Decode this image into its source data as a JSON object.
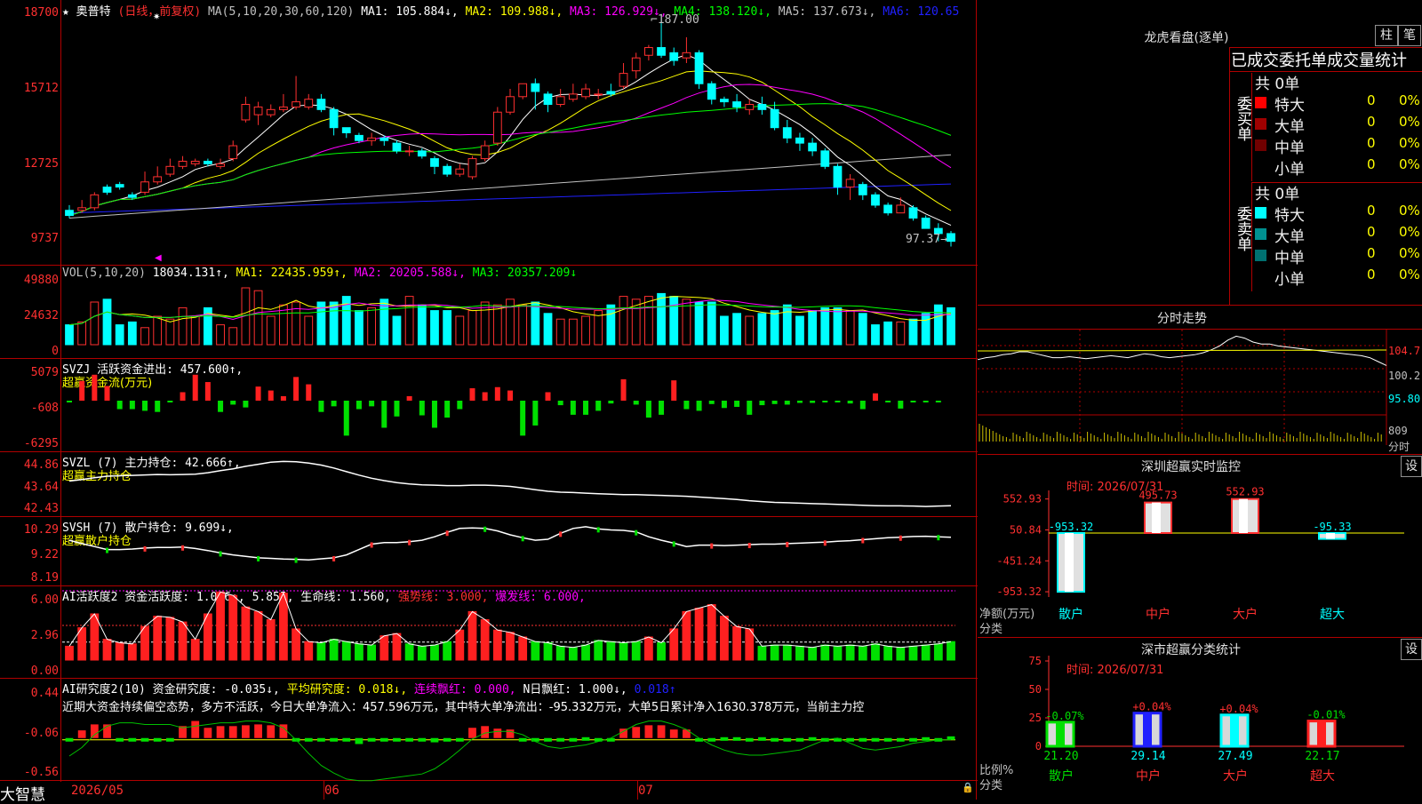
{
  "chart": {
    "stock_name": "奥普特",
    "period_label": "(日线，前复权)",
    "ma_header": "MA(5,10,20,30,60,120)",
    "ma_values": [
      {
        "label": "MA1: 105.884↓,",
        "color": "#ffffff"
      },
      {
        "label": "MA2: 109.988↓,",
        "color": "#ffff00"
      },
      {
        "label": "MA3: 126.929↓,",
        "color": "#ff00ff"
      },
      {
        "label": "MA4: 138.120↓,",
        "color": "#00ff00"
      },
      {
        "label": "MA5: 137.673↓,",
        "color": "#c0c0c0"
      },
      {
        "label": "MA6: 120.65",
        "color": "#2020ff"
      }
    ],
    "price_axis": [
      "18700",
      "15712",
      "12725",
      "9737"
    ],
    "high_annot": "187.00",
    "low_annot": "97.37→",
    "vol_header": "VOL(5,10,20)",
    "vol_value": "18034.131↑,",
    "vol_ma": [
      {
        "label": "MA1: 22435.959↑,",
        "color": "#ffff00"
      },
      {
        "label": "MA2: 20205.588↓,",
        "color": "#ff00ff"
      },
      {
        "label": "MA3: 20357.209↓",
        "color": "#00ff00"
      }
    ],
    "vol_axis": [
      "49880",
      "24632",
      "0"
    ],
    "svzj_header": "SVZJ  活跃资金进出: 457.600↑,",
    "svzj_sub": "超赢资金流(万元)",
    "svzj_axis": [
      "5079",
      "-608",
      "-6295"
    ],
    "svzl_header": "SVZL (7) 主力持仓: 42.666↑,",
    "svzl_sub": "超赢主力持仓",
    "svzl_axis": [
      "44.86",
      "43.64",
      "42.43"
    ],
    "svsh_header": "SVSH (7) 散户持仓: 9.699↓,",
    "svsh_sub": "超赢散户持仓",
    "svsh_axis": [
      "10.29",
      "9.22",
      "8.19"
    ],
    "ai1_header": "AI活跃度2 资金活跃度: 1.076↓, 5.855, 生命线: 1.560,",
    "ai1_strong": "强势线: 3.000,",
    "ai1_burst": "爆发线: 6.000,",
    "ai1_axis": [
      "6.00",
      "2.96",
      "0.00"
    ],
    "ai2_header_a": "AI研究度2(10) 资金研究度: -0.035↓,",
    "ai2_header_b": "平均研究度: 0.018↓,",
    "ai2_header_c": "连续飘红: 0.000,",
    "ai2_header_d": "N日飘红: 1.000↓,",
    "ai2_header_e": "0.018↑",
    "ai2_text": "近期大资金持续偏空态势，多方不活跃，今日大单净流入：457.596万元，其中特大单净流出：-95.332万元，大单5日累计净入1630.378万元，当前主力控",
    "ai2_axis": [
      "0.44",
      "-0.06",
      "-0.56"
    ],
    "brand": "大智慧",
    "date_labels": [
      "2026/05",
      "06",
      "07"
    ]
  },
  "right": {
    "lhb_title": "龙虎看盘(逐单)",
    "btn_bar": "柱",
    "btn_pen": "笔",
    "tabs_title": "已成交委托单成交量统计",
    "buy_label": "委买单",
    "sell_label": "委卖单",
    "buy_total": "共 0单",
    "sell_total": "共 0单",
    "buy_rows": [
      {
        "name": "特大",
        "count": "0",
        "pct": "0%",
        "color": "#ff0000"
      },
      {
        "name": "大单",
        "count": "0",
        "pct": "0%",
        "color": "#a00000"
      },
      {
        "name": "中单",
        "count": "0",
        "pct": "0%",
        "color": "#700000"
      },
      {
        "name": "小单",
        "count": "0",
        "pct": "0%",
        "color": "#000000"
      }
    ],
    "sell_rows": [
      {
        "name": "特大",
        "count": "0",
        "pct": "0%",
        "color": "#00ffff"
      },
      {
        "name": "大单",
        "count": "0",
        "pct": "0%",
        "color": "#009090"
      },
      {
        "name": "中单",
        "count": "0",
        "pct": "0%",
        "color": "#007070"
      },
      {
        "name": "小单",
        "count": "0",
        "pct": "0%",
        "color": "#000000"
      }
    ],
    "fs_title": "分时走势",
    "fs_axis": [
      "104.7",
      "100.2",
      "95.80",
      "809",
      "分时"
    ],
    "monitor_title": "深圳超赢实时监控",
    "monitor_btn": "设",
    "monitor_time": "时间: 2026/07/31",
    "monitor_axis": [
      "552.93",
      "50.84",
      "-451.24",
      "-953.32"
    ],
    "monitor_ylabel": "净额(万元)",
    "monitor_xlabel": "分类",
    "monitor_vals": [
      "-953.32",
      "495.73",
      "552.93",
      "-95.33"
    ],
    "monitor_cats": [
      "散户",
      "中户",
      "大户",
      "超大"
    ],
    "stat_title": "深市超赢分类统计",
    "stat_btn": "设",
    "stat_time": "时间: 2026/07/31",
    "stat_axis": [
      "75",
      "50",
      "25",
      "0"
    ],
    "stat_ylabel": "比例%",
    "stat_xlabel": "分类",
    "stat_top": [
      "-0.07%",
      "+0.04%",
      "+0.04%",
      "-0.01%"
    ],
    "stat_vals": [
      "21.20",
      "29.14",
      "27.49",
      "22.17"
    ],
    "stat_cats": [
      "散户",
      "中户",
      "大户",
      "超大"
    ]
  },
  "chart_data": {
    "type": "candlestick",
    "price_axis_range": [
      9737,
      18700
    ],
    "candles": [
      [
        111,
        109,
        113,
        108
      ],
      [
        111,
        112,
        115,
        110
      ],
      [
        112,
        117,
        118,
        111
      ],
      [
        120,
        118,
        121,
        117
      ],
      [
        121,
        120,
        122,
        119
      ],
      [
        117,
        116,
        118,
        115
      ],
      [
        118,
        122,
        126,
        117
      ],
      [
        122,
        124,
        128,
        121
      ],
      [
        125,
        128,
        131,
        124
      ],
      [
        128,
        130,
        132,
        127
      ],
      [
        129,
        130,
        131,
        128
      ],
      [
        130,
        129,
        131,
        128
      ],
      [
        128,
        129,
        131,
        127
      ],
      [
        131,
        136,
        138,
        130
      ],
      [
        146,
        152,
        155,
        145
      ],
      [
        148,
        151,
        153,
        144
      ],
      [
        148,
        150,
        152,
        147
      ],
      [
        150,
        151,
        156,
        149
      ],
      [
        151,
        153,
        163,
        150
      ],
      [
        151,
        154,
        156,
        150
      ],
      [
        154,
        150,
        156,
        149
      ],
      [
        150,
        143,
        151,
        140
      ],
      [
        143,
        141,
        142,
        139
      ],
      [
        140,
        138,
        141,
        137
      ],
      [
        138,
        139,
        141,
        136
      ],
      [
        139,
        138,
        140,
        136
      ],
      [
        137,
        134,
        138,
        133
      ],
      [
        134,
        134,
        136,
        132
      ],
      [
        134,
        132,
        135,
        131
      ],
      [
        131,
        128,
        132,
        125
      ],
      [
        128,
        125,
        129,
        124
      ],
      [
        125,
        127,
        129,
        124
      ],
      [
        124,
        131,
        132,
        123
      ],
      [
        131,
        136,
        138,
        130
      ],
      [
        137,
        149,
        151,
        136
      ],
      [
        149,
        155,
        158,
        148
      ],
      [
        155,
        160,
        160,
        154
      ],
      [
        160,
        157,
        162,
        150
      ],
      [
        156,
        152,
        157,
        149
      ],
      [
        152,
        155,
        158,
        151
      ],
      [
        154,
        156,
        160,
        153
      ],
      [
        155,
        158,
        160,
        154
      ],
      [
        156,
        156,
        158,
        154
      ],
      [
        157,
        156,
        160,
        155
      ],
      [
        159,
        164,
        168,
        158
      ],
      [
        165,
        170,
        172,
        162
      ],
      [
        171,
        174,
        175,
        169
      ],
      [
        174,
        171,
        187,
        170
      ],
      [
        172,
        169,
        174,
        167
      ],
      [
        170,
        172,
        178,
        168
      ],
      [
        172,
        160,
        173,
        158
      ],
      [
        160,
        154,
        161,
        152
      ],
      [
        154,
        153,
        155,
        151
      ],
      [
        153,
        151,
        156,
        149
      ],
      [
        150,
        152,
        154,
        148
      ],
      [
        152,
        150,
        155,
        148
      ],
      [
        150,
        143,
        153,
        142
      ],
      [
        143,
        139,
        146,
        137
      ],
      [
        139,
        137,
        141,
        134
      ],
      [
        137,
        134,
        139,
        132
      ],
      [
        134,
        128,
        135,
        127
      ],
      [
        128,
        120,
        129,
        117
      ],
      [
        120,
        123,
        125,
        115
      ],
      [
        121,
        117,
        122,
        115
      ],
      [
        117,
        113,
        118,
        112
      ],
      [
        113,
        110,
        114,
        109
      ],
      [
        110,
        113,
        116,
        110
      ],
      [
        112,
        108,
        113,
        107
      ],
      [
        108,
        104,
        109,
        104
      ],
      [
        104,
        102,
        106,
        99
      ],
      [
        102,
        99,
        103,
        97
      ]
    ],
    "volume": [
      14,
      16,
      30,
      32,
      14,
      16,
      12,
      20,
      18,
      26,
      20,
      26,
      14,
      12,
      40,
      38,
      20,
      28,
      30,
      20,
      30,
      30,
      34,
      24,
      26,
      32,
      20,
      34,
      28,
      24,
      24,
      20,
      24,
      30,
      28,
      32,
      28,
      30,
      22,
      18,
      18,
      20,
      24,
      28,
      34,
      32,
      34,
      36,
      34,
      32,
      30,
      30,
      20,
      22,
      20,
      22,
      24,
      28,
      20,
      24,
      26,
      26,
      24,
      22,
      14,
      16,
      16,
      18,
      22,
      28,
      26,
      18,
      20
    ],
    "svzj": [
      -0.3,
      3.5,
      4.6,
      2.6,
      -1.5,
      -1.5,
      -1.8,
      -2.0,
      -0.1,
      1.5,
      4.6,
      3.3,
      -2.0,
      -0.7,
      -1.2,
      2.5,
      1.8,
      0.8,
      4.2,
      2.9,
      -2.0,
      -1.0,
      -6.2,
      -1.5,
      -1.0,
      -4.8,
      -2.8,
      0.8,
      -2.6,
      -4.8,
      -3.0,
      -1.5,
      2.2,
      1.5,
      2.4,
      1.8,
      -6.2,
      -4.4,
      1.5,
      -0.8,
      -2.5,
      -2.5,
      -1.8,
      -0.5,
      3.8,
      -0.7,
      -3.0,
      -2.5,
      3.6,
      -1.5,
      -1.8,
      -0.6,
      -1.3,
      -1.1,
      -2.5,
      -0.8,
      -0.6,
      -0.7,
      -0.4,
      -0.4,
      -0.3,
      -0.3,
      -0.5,
      -1.5,
      1.3,
      -0.3,
      -1.4,
      -0.3,
      -0.3,
      -0.3
    ],
    "svzl": [
      43.84,
      43.92,
      44.0,
      44.08,
      44.1,
      44.12,
      44.14,
      44.16,
      44.15,
      44.16,
      44.18,
      44.25,
      44.35,
      44.44,
      44.56,
      44.66,
      44.76,
      44.8,
      44.78,
      44.72,
      44.62,
      44.48,
      44.3,
      44.13,
      43.98,
      43.86,
      43.76,
      43.7,
      43.66,
      43.64,
      43.62,
      43.62,
      43.64,
      43.64,
      43.62,
      43.58,
      43.5,
      43.42,
      43.34,
      43.3,
      43.28,
      43.25,
      43.22,
      43.2,
      43.18,
      43.18,
      43.16,
      43.14,
      43.12,
      43.1,
      43.06,
      43.02,
      42.98,
      42.94,
      42.88,
      42.84,
      42.8,
      42.78,
      42.76,
      42.74,
      42.72,
      42.7,
      42.68,
      42.66,
      42.64,
      42.63,
      42.63,
      42.62,
      42.6,
      42.62,
      42.64,
      42.66
    ],
    "svsh": [
      9.6,
      9.46,
      9.34,
      9.22,
      9.22,
      9.24,
      9.28,
      9.3,
      9.3,
      9.32,
      9.26,
      9.18,
      9.08,
      9.0,
      8.94,
      8.88,
      8.86,
      8.83,
      8.82,
      8.8,
      8.84,
      8.88,
      9.0,
      9.22,
      9.44,
      9.5,
      9.5,
      9.54,
      9.6,
      9.74,
      9.92,
      10.08,
      10.1,
      10.08,
      9.98,
      9.82,
      9.7,
      9.6,
      9.64,
      9.88,
      10.08,
      10.15,
      10.06,
      10.02,
      10.0,
      9.94,
      9.74,
      9.6,
      9.48,
      9.34,
      9.4,
      9.4,
      9.38,
      9.4,
      9.42,
      9.44,
      9.44,
      9.46,
      9.48,
      9.5,
      9.52,
      9.56,
      9.58,
      9.62,
      9.66,
      9.7,
      9.72,
      9.75,
      9.76,
      9.74,
      9.72,
      9.7
    ],
    "ai1": [
      1.2,
      2.8,
      4.0,
      1.8,
      1.5,
      1.4,
      2.9,
      3.8,
      3.7,
      3.3,
      1.8,
      4.0,
      5.9,
      5.6,
      4.6,
      4.2,
      3.5,
      5.8,
      2.7,
      1.6,
      1.5,
      1.8,
      1.6,
      1.4,
      1.3,
      2.1,
      2.3,
      1.4,
      1.2,
      1.3,
      1.6,
      2.6,
      4.2,
      3.5,
      2.6,
      2.4,
      2.0,
      1.6,
      1.5,
      1.2,
      1.1,
      1.3,
      1.7,
      1.6,
      1.5,
      1.6,
      2.0,
      1.5,
      2.7,
      4.2,
      4.5,
      4.8,
      3.8,
      2.9,
      2.7,
      1.2,
      1.3,
      1.3,
      1.2,
      1.1,
      1.3,
      1.2,
      1.3,
      1.2,
      1.4,
      1.2,
      1.1,
      1.2,
      1.3,
      1.4,
      1.6,
      1.3,
      1.1
    ],
    "ai2_bars": [
      -0.06,
      0.03,
      0.1,
      0.1,
      -0.06,
      -0.06,
      -0.06,
      -0.06,
      -0.06,
      0.08,
      0.14,
      0.06,
      0.08,
      0.08,
      0.09,
      0.1,
      0.09,
      0.1,
      -0.06,
      -0.06,
      -0.08,
      -0.08,
      -0.1,
      -0.13,
      -0.1,
      -0.08,
      -0.09,
      -0.08,
      -0.07,
      -0.11,
      -0.1,
      -0.08,
      0.06,
      0.08,
      0.05,
      0.04,
      -0.06,
      -0.06,
      -0.09,
      -0.06,
      -0.06,
      -0.05,
      -0.06,
      -0.06,
      0.05,
      0.07,
      0.09,
      0.09,
      0.04,
      0.04,
      -0.06,
      -0.06,
      -0.05,
      -0.05,
      -0.06,
      -0.05,
      -0.06,
      -0.07,
      -0.06,
      -0.05,
      -0.06,
      -0.06,
      -0.08,
      -0.06,
      -0.06,
      -0.06,
      -0.07,
      -0.06,
      -0.05,
      -0.06,
      -0.04,
      -0.04
    ],
    "ai2_line": [
      -0.25,
      -0.15,
      0.0,
      0.1,
      0.14,
      0.14,
      0.12,
      0.12,
      0.12,
      0.08,
      0.1,
      0.12,
      0.14,
      0.14,
      0.16,
      0.16,
      0.14,
      0.08,
      -0.06,
      -0.22,
      -0.36,
      -0.45,
      -0.52,
      -0.54,
      -0.54,
      -0.52,
      -0.5,
      -0.48,
      -0.46,
      -0.4,
      -0.3,
      -0.18,
      -0.05,
      0.02,
      0.04,
      0.04,
      0.0,
      -0.08,
      -0.14,
      -0.16,
      -0.14,
      -0.12,
      -0.08,
      -0.04,
      0.04,
      0.12,
      0.16,
      0.16,
      0.12,
      0.06,
      -0.04,
      -0.12,
      -0.18,
      -0.22,
      -0.24,
      -0.24,
      -0.22,
      -0.2,
      -0.18,
      -0.12,
      -0.06,
      -0.04,
      -0.1,
      -0.16,
      -0.18,
      -0.16,
      -0.14,
      -0.1,
      -0.08,
      -0.06,
      -0.06,
      -0.05
    ],
    "fs_line": [
      0.42,
      0.44,
      0.45,
      0.47,
      0.48,
      0.5,
      0.5,
      0.48,
      0.46,
      0.44,
      0.44,
      0.45,
      0.44,
      0.43,
      0.44,
      0.45,
      0.46,
      0.45,
      0.44,
      0.46,
      0.48,
      0.47,
      0.45,
      0.44,
      0.45,
      0.46,
      0.47,
      0.49,
      0.52,
      0.56,
      0.62,
      0.66,
      0.64,
      0.6,
      0.58,
      0.58,
      0.56,
      0.55,
      0.54,
      0.53,
      0.52,
      0.51,
      0.5,
      0.49,
      0.48,
      0.47,
      0.46,
      0.44,
      0.4,
      0.36
    ]
  }
}
